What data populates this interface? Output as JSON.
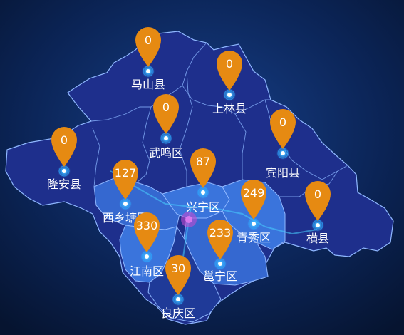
{
  "map": {
    "colors": {
      "background": "#07183a",
      "region_dark": "#1e2f8c",
      "region_light": "#3a6fd6",
      "region_border": "#8fb7ff",
      "pin": "#e68a12",
      "marker": "#27a5ff"
    },
    "icons": {
      "pin": "map-pin-icon",
      "marker": "location-marker-icon"
    },
    "districts": [
      {
        "name": "马山县",
        "value": "0"
      },
      {
        "name": "上林县",
        "value": "0"
      },
      {
        "name": "武鸣区",
        "value": "0"
      },
      {
        "name": "宾阳县",
        "value": "0"
      },
      {
        "name": "隆安县",
        "value": "0"
      },
      {
        "name": "西乡塘区",
        "value": "127"
      },
      {
        "name": "兴宁区",
        "value": "87"
      },
      {
        "name": "青秀区",
        "value": "249"
      },
      {
        "name": "横县",
        "value": "0"
      },
      {
        "name": "江南区",
        "value": "330"
      },
      {
        "name": "邕宁区",
        "value": "233"
      },
      {
        "name": "良庆区",
        "value": "30"
      }
    ]
  }
}
